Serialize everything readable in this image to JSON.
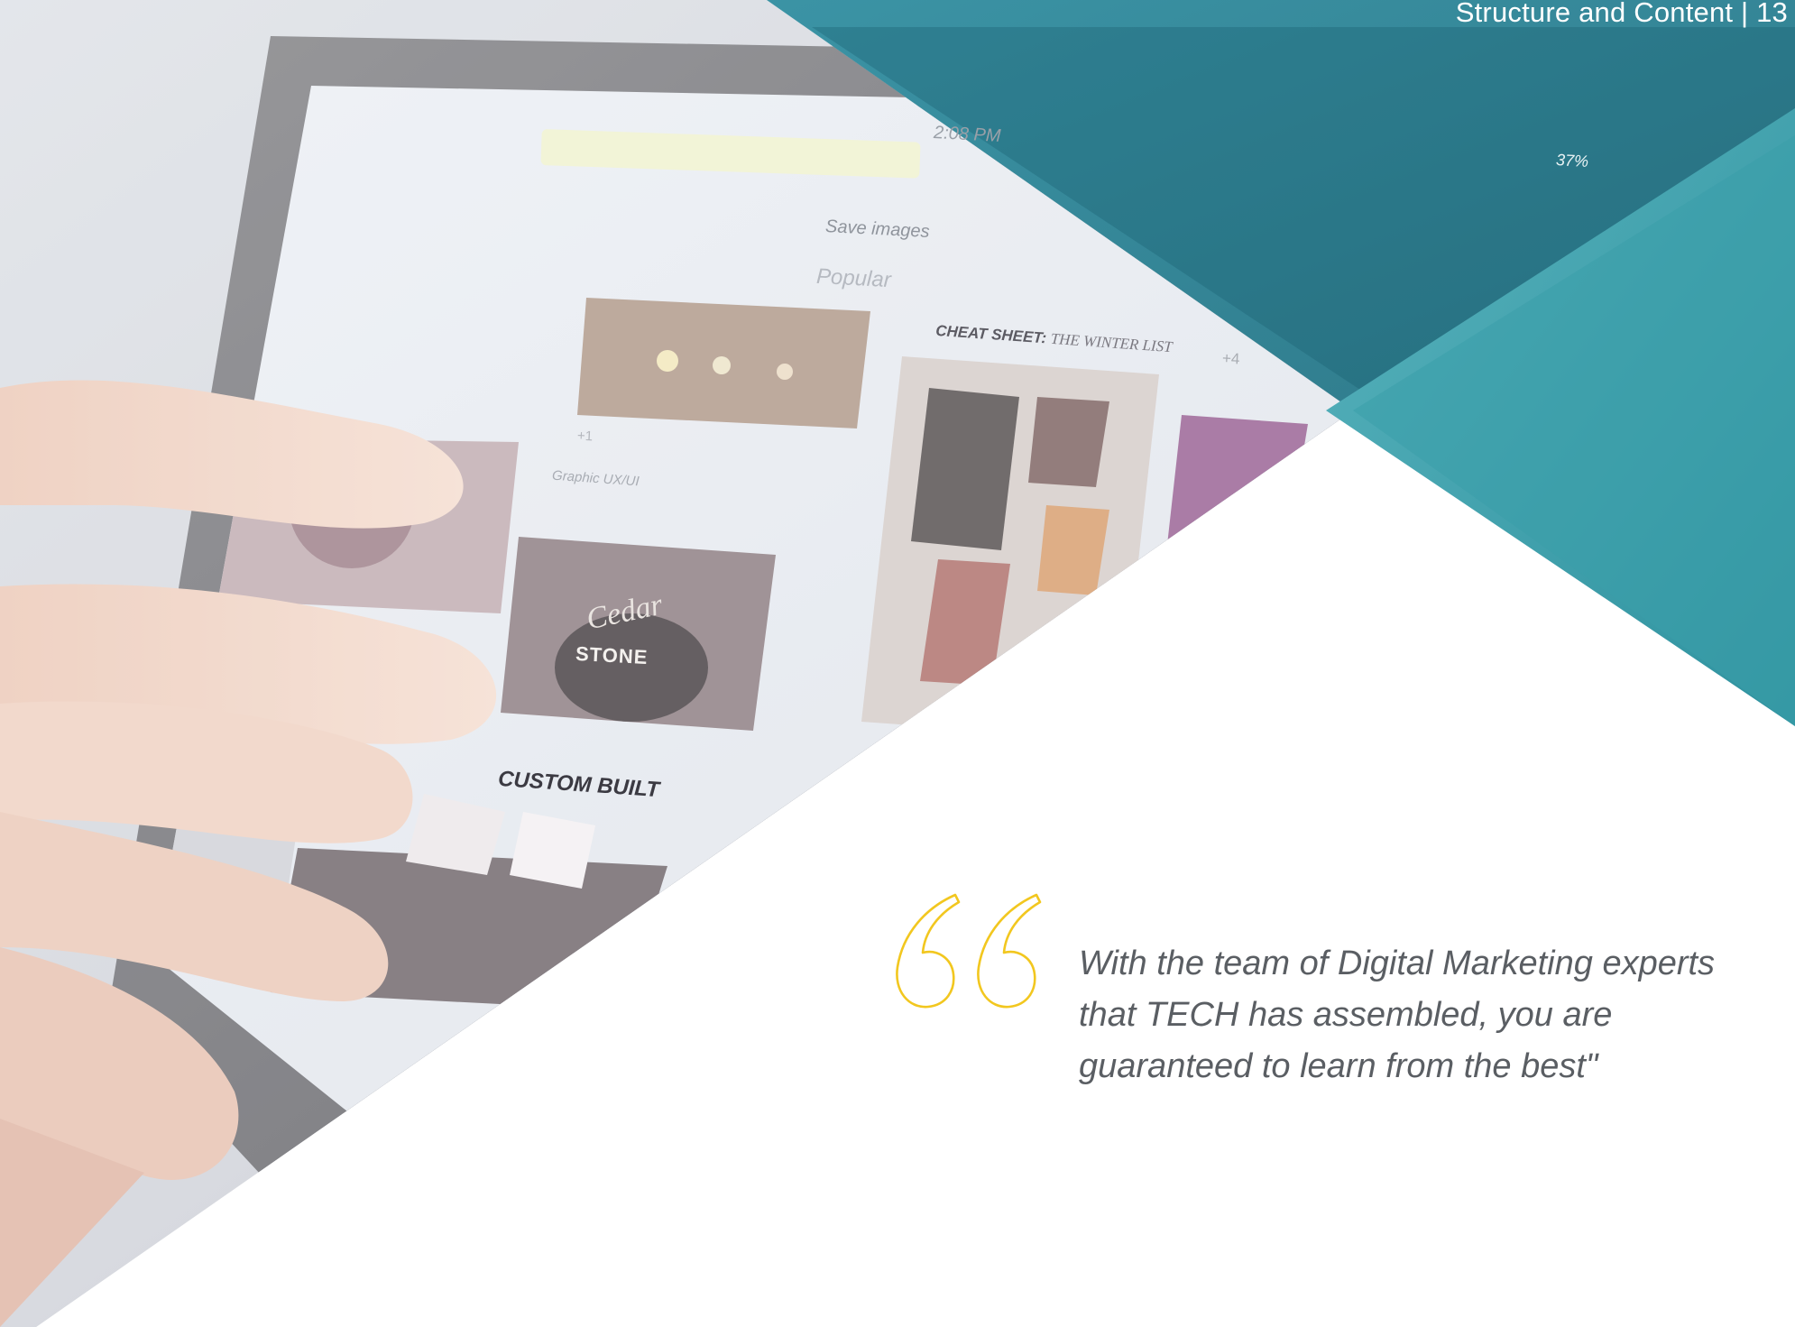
{
  "header": {
    "text": "Structure and Content | 13"
  },
  "photo": {
    "description_icon": "hand-touching-tablet-photo",
    "screen_texts": {
      "time": "2:08 PM",
      "battery": "37%",
      "save_images": "Save images",
      "popular": "Popular",
      "cheat_sheet": "CHEAT SHEET:",
      "winter_list": "THE WINTER LIST",
      "graphic": "Graphic UX/UI",
      "cedar": "Cedar",
      "stone": "STONE",
      "custom_built": "CUSTOM BUILT",
      "plus_four": "+4",
      "plus_four_left": "+1"
    }
  },
  "quote": {
    "text": "With the team of Digital Marketing experts that TECH has assembled, you are guaranteed to learn from the best\"",
    "mark_icon": "quote-mark-icon"
  },
  "colors": {
    "teal_dark": "#1e6f80",
    "teal_mid": "#2b8e9f",
    "teal_light": "#49aab6",
    "quote_yellow": "#f2c71f",
    "text_gray": "#5a5e63"
  }
}
